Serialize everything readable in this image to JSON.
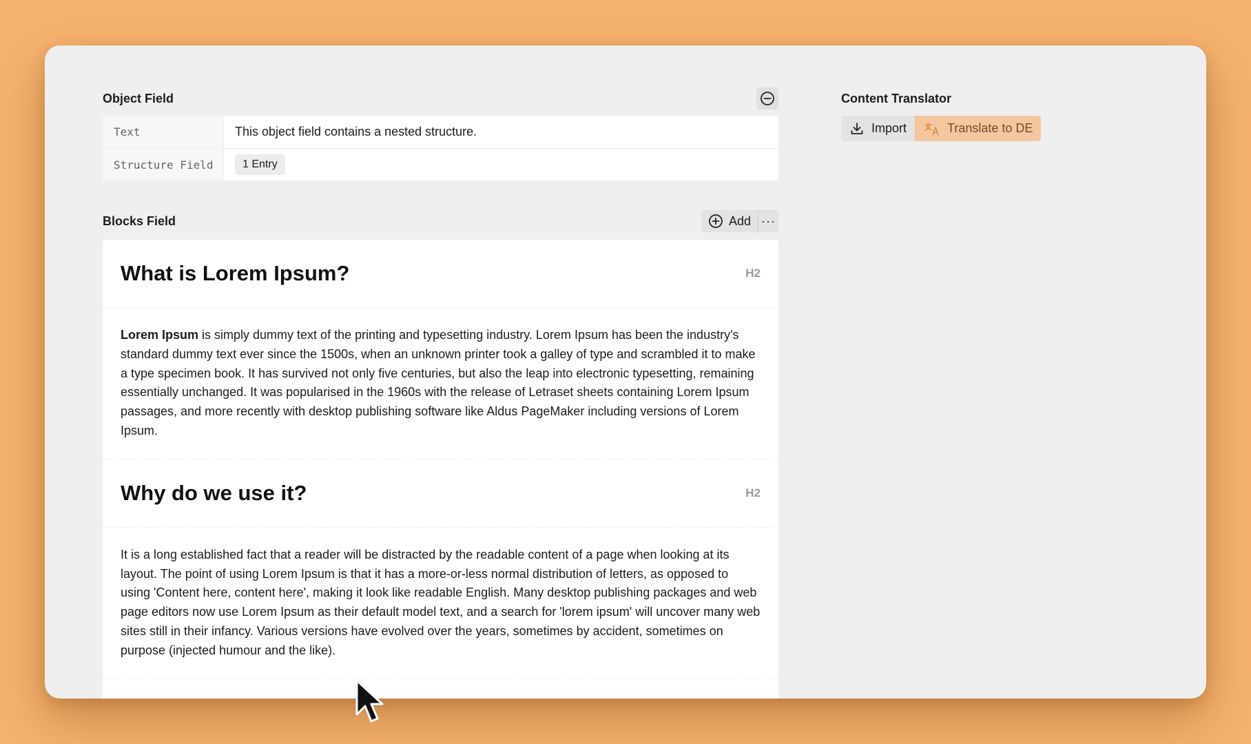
{
  "object_field": {
    "title": "Object Field",
    "rows": [
      {
        "label": "Text",
        "value": "This object field contains a nested structure."
      },
      {
        "label": "Structure Field",
        "value": "1 Entry"
      }
    ]
  },
  "blocks_field": {
    "title": "Blocks Field",
    "add_label": "Add",
    "more_label": "···",
    "blocks": [
      {
        "type": "heading",
        "text": "What is Lorem Ipsum?",
        "tag": "H2"
      },
      {
        "type": "text",
        "bold": "Lorem Ipsum",
        "text": " is simply dummy text of the printing and  typesetting industry. Lorem Ipsum has been the industry's standard  dummy text ever since the 1500s, when an unknown printer took a galley  of type and scrambled it to make a type specimen book. It has survived  not only five centuries, but also the leap into electronic typesetting,  remaining essentially unchanged. It was popularised in the 1960s with  the release of Letraset sheets containing Lorem Ipsum passages, and more  recently with desktop publishing software like Aldus PageMaker  including versions of Lorem Ipsum."
      },
      {
        "type": "heading",
        "text": "Why do we use it?",
        "tag": "H2"
      },
      {
        "type": "text",
        "text": "It is a long established fact that a reader will be distracted by the  readable content of a page when looking at its layout. The point of  using Lorem Ipsum is that it has a more-or-less normal distribution of  letters, as opposed to using 'Content here, content here', making it  look like readable English. Many desktop publishing packages and web  page editors now use Lorem Ipsum as their default model text, and a  search for 'lorem ipsum' will uncover many web sites still in their  infancy. Various versions have evolved over the years, sometimes by  accident, sometimes on purpose (injected humour and the like)."
      }
    ]
  },
  "content_translator": {
    "title": "Content Translator",
    "import_label": "Import",
    "translate_label": "Translate to DE"
  },
  "colors": {
    "background": "#f6b26f",
    "panel": "#efefef",
    "translate_accent": "#f5c79e"
  }
}
